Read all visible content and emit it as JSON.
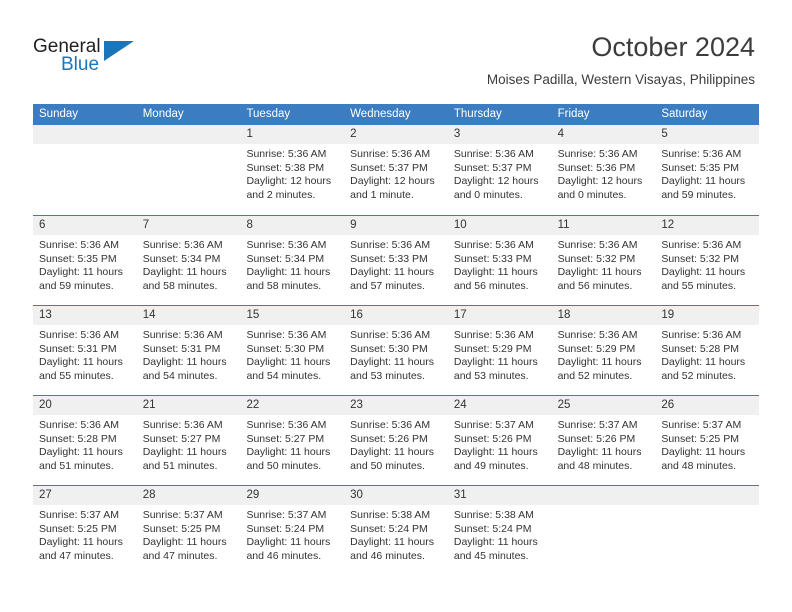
{
  "brand": {
    "name_top": "General",
    "name_bottom": "Blue",
    "triangle_icon": "triangle-icon",
    "color_dark": "#231f20",
    "color_blue": "#1b75bb"
  },
  "header": {
    "title": "October 2024",
    "subtitle": "Moises Padilla, Western Visayas, Philippines"
  },
  "colors": {
    "header_blue": "#3b7dc0",
    "day_band_gray": "#f0f0f0",
    "text": "#333333"
  },
  "weekdays": [
    "Sunday",
    "Monday",
    "Tuesday",
    "Wednesday",
    "Thursday",
    "Friday",
    "Saturday"
  ],
  "weeks": [
    [
      {
        "day": "",
        "empty": true
      },
      {
        "day": "",
        "empty": true
      },
      {
        "day": "1",
        "sunrise": "Sunrise: 5:36 AM",
        "sunset": "Sunset: 5:38 PM",
        "daylight": "Daylight: 12 hours and 2 minutes."
      },
      {
        "day": "2",
        "sunrise": "Sunrise: 5:36 AM",
        "sunset": "Sunset: 5:37 PM",
        "daylight": "Daylight: 12 hours and 1 minute."
      },
      {
        "day": "3",
        "sunrise": "Sunrise: 5:36 AM",
        "sunset": "Sunset: 5:37 PM",
        "daylight": "Daylight: 12 hours and 0 minutes."
      },
      {
        "day": "4",
        "sunrise": "Sunrise: 5:36 AM",
        "sunset": "Sunset: 5:36 PM",
        "daylight": "Daylight: 12 hours and 0 minutes."
      },
      {
        "day": "5",
        "sunrise": "Sunrise: 5:36 AM",
        "sunset": "Sunset: 5:35 PM",
        "daylight": "Daylight: 11 hours and 59 minutes."
      }
    ],
    [
      {
        "day": "6",
        "sunrise": "Sunrise: 5:36 AM",
        "sunset": "Sunset: 5:35 PM",
        "daylight": "Daylight: 11 hours and 59 minutes."
      },
      {
        "day": "7",
        "sunrise": "Sunrise: 5:36 AM",
        "sunset": "Sunset: 5:34 PM",
        "daylight": "Daylight: 11 hours and 58 minutes."
      },
      {
        "day": "8",
        "sunrise": "Sunrise: 5:36 AM",
        "sunset": "Sunset: 5:34 PM",
        "daylight": "Daylight: 11 hours and 58 minutes."
      },
      {
        "day": "9",
        "sunrise": "Sunrise: 5:36 AM",
        "sunset": "Sunset: 5:33 PM",
        "daylight": "Daylight: 11 hours and 57 minutes."
      },
      {
        "day": "10",
        "sunrise": "Sunrise: 5:36 AM",
        "sunset": "Sunset: 5:33 PM",
        "daylight": "Daylight: 11 hours and 56 minutes."
      },
      {
        "day": "11",
        "sunrise": "Sunrise: 5:36 AM",
        "sunset": "Sunset: 5:32 PM",
        "daylight": "Daylight: 11 hours and 56 minutes."
      },
      {
        "day": "12",
        "sunrise": "Sunrise: 5:36 AM",
        "sunset": "Sunset: 5:32 PM",
        "daylight": "Daylight: 11 hours and 55 minutes."
      }
    ],
    [
      {
        "day": "13",
        "sunrise": "Sunrise: 5:36 AM",
        "sunset": "Sunset: 5:31 PM",
        "daylight": "Daylight: 11 hours and 55 minutes."
      },
      {
        "day": "14",
        "sunrise": "Sunrise: 5:36 AM",
        "sunset": "Sunset: 5:31 PM",
        "daylight": "Daylight: 11 hours and 54 minutes."
      },
      {
        "day": "15",
        "sunrise": "Sunrise: 5:36 AM",
        "sunset": "Sunset: 5:30 PM",
        "daylight": "Daylight: 11 hours and 54 minutes."
      },
      {
        "day": "16",
        "sunrise": "Sunrise: 5:36 AM",
        "sunset": "Sunset: 5:30 PM",
        "daylight": "Daylight: 11 hours and 53 minutes."
      },
      {
        "day": "17",
        "sunrise": "Sunrise: 5:36 AM",
        "sunset": "Sunset: 5:29 PM",
        "daylight": "Daylight: 11 hours and 53 minutes."
      },
      {
        "day": "18",
        "sunrise": "Sunrise: 5:36 AM",
        "sunset": "Sunset: 5:29 PM",
        "daylight": "Daylight: 11 hours and 52 minutes."
      },
      {
        "day": "19",
        "sunrise": "Sunrise: 5:36 AM",
        "sunset": "Sunset: 5:28 PM",
        "daylight": "Daylight: 11 hours and 52 minutes."
      }
    ],
    [
      {
        "day": "20",
        "sunrise": "Sunrise: 5:36 AM",
        "sunset": "Sunset: 5:28 PM",
        "daylight": "Daylight: 11 hours and 51 minutes."
      },
      {
        "day": "21",
        "sunrise": "Sunrise: 5:36 AM",
        "sunset": "Sunset: 5:27 PM",
        "daylight": "Daylight: 11 hours and 51 minutes."
      },
      {
        "day": "22",
        "sunrise": "Sunrise: 5:36 AM",
        "sunset": "Sunset: 5:27 PM",
        "daylight": "Daylight: 11 hours and 50 minutes."
      },
      {
        "day": "23",
        "sunrise": "Sunrise: 5:36 AM",
        "sunset": "Sunset: 5:26 PM",
        "daylight": "Daylight: 11 hours and 50 minutes."
      },
      {
        "day": "24",
        "sunrise": "Sunrise: 5:37 AM",
        "sunset": "Sunset: 5:26 PM",
        "daylight": "Daylight: 11 hours and 49 minutes."
      },
      {
        "day": "25",
        "sunrise": "Sunrise: 5:37 AM",
        "sunset": "Sunset: 5:26 PM",
        "daylight": "Daylight: 11 hours and 48 minutes."
      },
      {
        "day": "26",
        "sunrise": "Sunrise: 5:37 AM",
        "sunset": "Sunset: 5:25 PM",
        "daylight": "Daylight: 11 hours and 48 minutes."
      }
    ],
    [
      {
        "day": "27",
        "sunrise": "Sunrise: 5:37 AM",
        "sunset": "Sunset: 5:25 PM",
        "daylight": "Daylight: 11 hours and 47 minutes."
      },
      {
        "day": "28",
        "sunrise": "Sunrise: 5:37 AM",
        "sunset": "Sunset: 5:25 PM",
        "daylight": "Daylight: 11 hours and 47 minutes."
      },
      {
        "day": "29",
        "sunrise": "Sunrise: 5:37 AM",
        "sunset": "Sunset: 5:24 PM",
        "daylight": "Daylight: 11 hours and 46 minutes."
      },
      {
        "day": "30",
        "sunrise": "Sunrise: 5:38 AM",
        "sunset": "Sunset: 5:24 PM",
        "daylight": "Daylight: 11 hours and 46 minutes."
      },
      {
        "day": "31",
        "sunrise": "Sunrise: 5:38 AM",
        "sunset": "Sunset: 5:24 PM",
        "daylight": "Daylight: 11 hours and 45 minutes."
      },
      {
        "day": "",
        "empty": true
      },
      {
        "day": "",
        "empty": true
      }
    ]
  ]
}
